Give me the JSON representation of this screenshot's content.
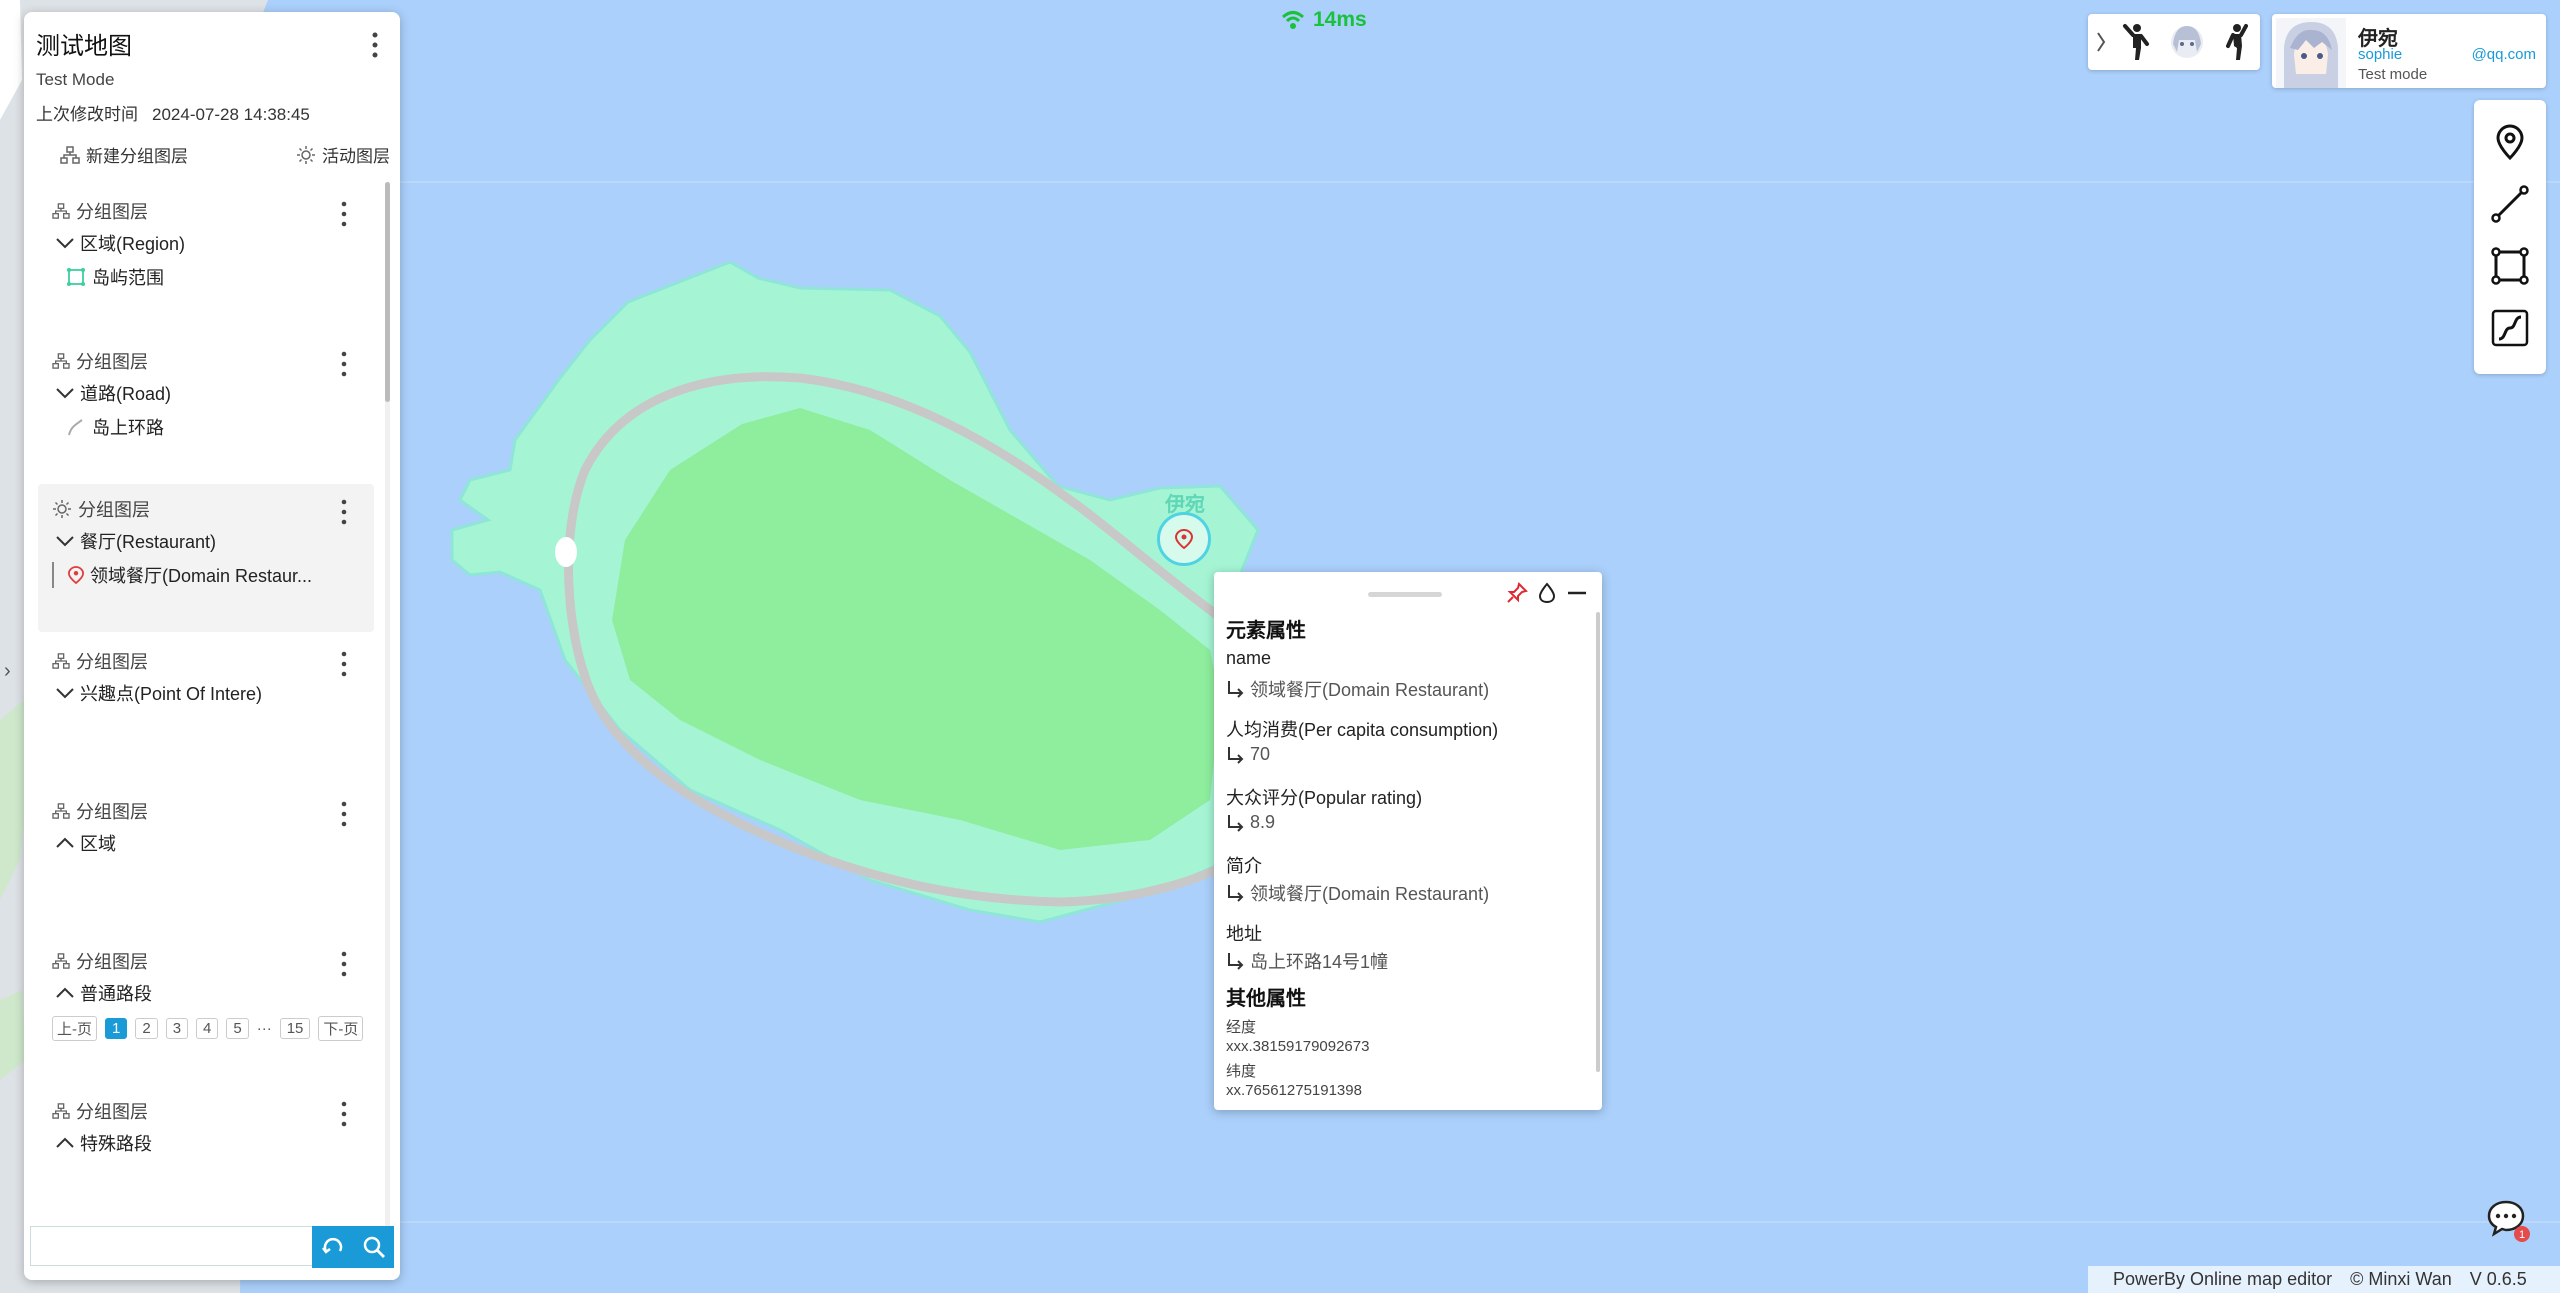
{
  "network": {
    "latency": "14ms"
  },
  "map": {
    "marker_label": "伊宛",
    "water_color": "#abd0fb",
    "island_color": "#a5f5d5",
    "inner_color": "#8eee9e",
    "road_color": "#c8c8c8"
  },
  "panel": {
    "title": "测试地图",
    "mode": "Test Mode",
    "modified_label": "上次修改时间",
    "modified_time": "2024-07-28 14:38:45",
    "new_group_layer": "新建分组图层",
    "active_layer": "活动图层",
    "groups": [
      {
        "head": "分组图层",
        "layer": "区域(Region)",
        "item": "岛屿范围"
      },
      {
        "head": "分组图层",
        "layer": "道路(Road)",
        "item": "岛上环路"
      },
      {
        "head": "分组图层",
        "layer": "餐厅(Restaurant)",
        "item": "领域餐厅(Domain Restaur..."
      },
      {
        "head": "分组图层",
        "layer": "兴趣点(Point Of Intere)"
      },
      {
        "head": "分组图层",
        "layer": "区域"
      },
      {
        "head": "分组图层",
        "layer": "普通路段"
      },
      {
        "head": "分组图层",
        "layer": "特殊路段"
      }
    ],
    "pager": {
      "prev": "上-页",
      "pages": [
        "1",
        "2",
        "3",
        "4",
        "5"
      ],
      "ellipsis": "···",
      "last": "15",
      "next": "下-页"
    },
    "search_placeholder": ""
  },
  "profile": {
    "name": "伊宛",
    "user": "sophie",
    "mail": "@qq.com",
    "mode": "Test mode"
  },
  "popup": {
    "title": "元素属性",
    "attrs": [
      {
        "key": "name",
        "value": "领域餐厅(Domain Restaurant)"
      },
      {
        "key": "人均消费(Per capita consumption)",
        "value": "70"
      },
      {
        "key": "大众评分(Popular rating)",
        "value": "8.9"
      },
      {
        "key": "简介",
        "value": "领域餐厅(Domain Restaurant)"
      },
      {
        "key": "地址",
        "value": "岛上环路14号1幢"
      }
    ],
    "other_title": "其他属性",
    "lon_label": "经度",
    "lon_value": "xxx.38159179092673",
    "lat_label": "纬度",
    "lat_value": "xx.76561275191398"
  },
  "chat": {
    "badge": "1"
  },
  "footer": {
    "powered": "PowerBy Online map editor",
    "author": "© Minxi Wan",
    "version": "V 0.6.5"
  }
}
